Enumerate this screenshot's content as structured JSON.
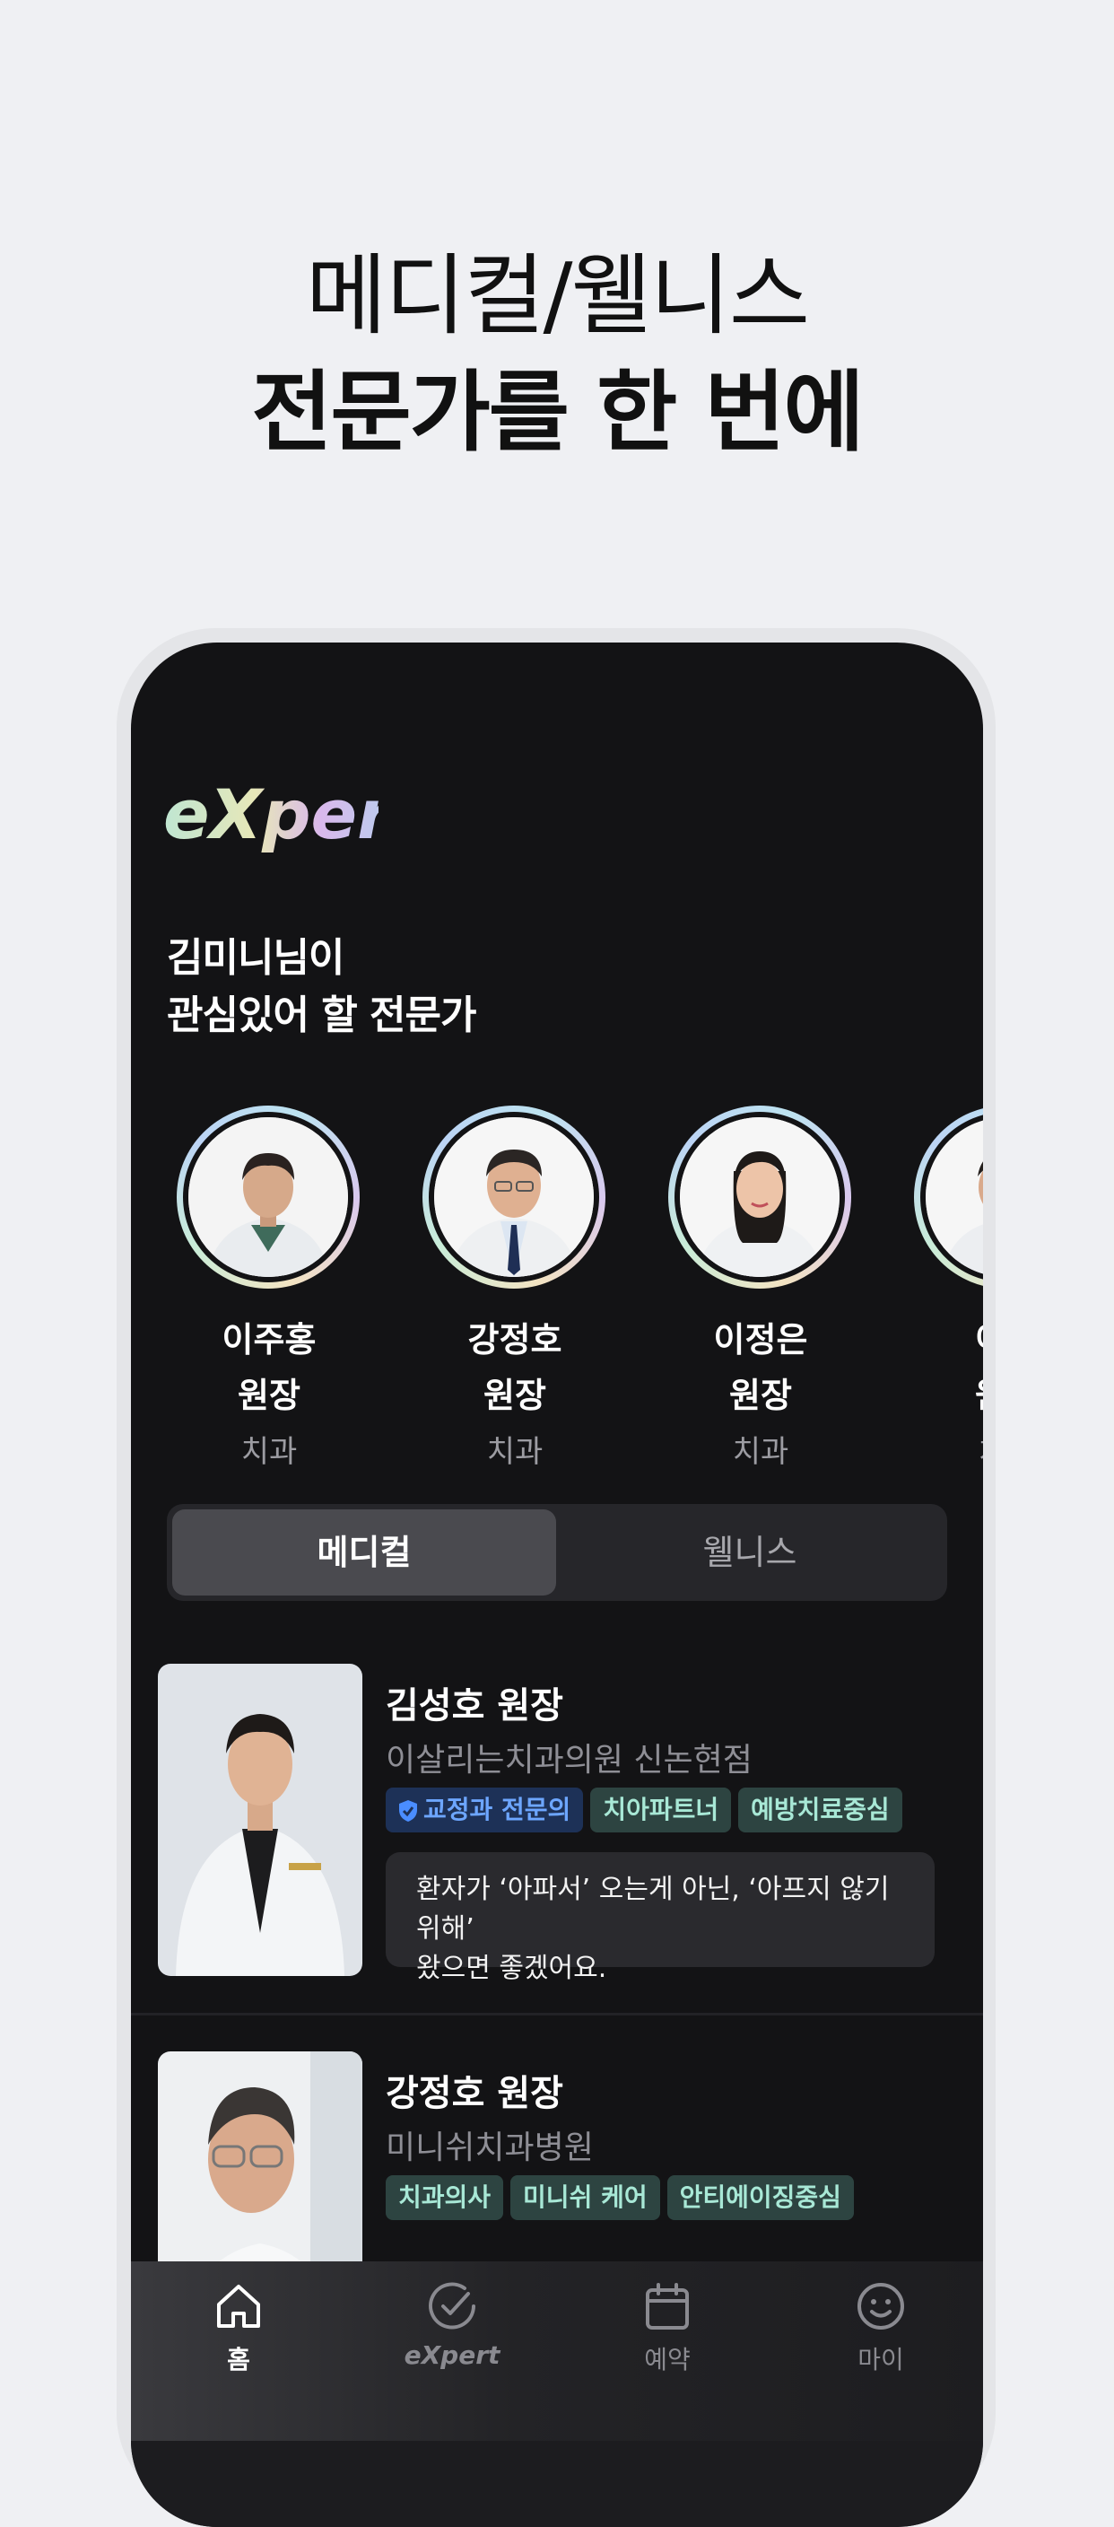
{
  "headline": {
    "line1": "메디컬/웰니스",
    "line2": "전문가를 한 번에"
  },
  "app": {
    "logo_text": "eXpert",
    "greeting_line1": "김미니님이",
    "greeting_line2": "관심있어 할 전문가"
  },
  "experts": [
    {
      "name_line1": "이주홍",
      "name_line2": "원장",
      "dept": "치과"
    },
    {
      "name_line1": "강정호",
      "name_line2": "원장",
      "dept": "치과"
    },
    {
      "name_line1": "이정은",
      "name_line2": "원장",
      "dept": "치과"
    },
    {
      "name_line1": "이상",
      "name_line2": "원장",
      "dept": "치과"
    }
  ],
  "segment": {
    "active": "메디컬",
    "inactive": "웰니스"
  },
  "cards": [
    {
      "name": "김성호 원장",
      "clinic": "이살리는치과의원 신논현점",
      "tags": [
        "교정과 전문의",
        "치아파트너",
        "예방치료중심"
      ],
      "quote_line1": "환자가 ‘아파서’ 오는게 아닌, ‘아프지 않기위해’",
      "quote_line2": "왔으면 좋겠어요."
    },
    {
      "name": "강정호 원장",
      "clinic": "미니쉬치과병원",
      "tags": [
        "치과의사",
        "미니쉬 케어",
        "안티에이징중심"
      ]
    }
  ],
  "tabbar": {
    "home": "홈",
    "expert": "eXpert",
    "reserve": "예약",
    "my": "마이"
  },
  "colors": {
    "background": "#eff0f3",
    "app_background": "#131315",
    "tag_green_text": "#a8e8d6",
    "tag_blue_text": "#6da6ff"
  }
}
